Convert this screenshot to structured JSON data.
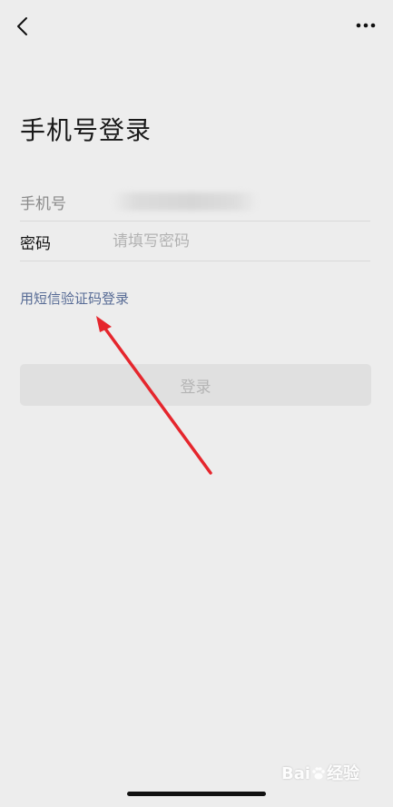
{
  "header": {
    "back_icon": "chevron-left-icon",
    "more_icon": "more-dots-icon"
  },
  "title": "手机号登录",
  "form": {
    "phone_label": "手机号",
    "password_label": "密码",
    "password_placeholder": "请填写密码"
  },
  "sms_link": "用短信验证码登录",
  "login_button": "登录",
  "watermark": {
    "prefix": "Bai",
    "suffix": "经验"
  },
  "colors": {
    "background": "#ededed",
    "link": "#576b95",
    "annotation_arrow": "#e5262d",
    "button_disabled_bg": "#e0e0e0"
  }
}
